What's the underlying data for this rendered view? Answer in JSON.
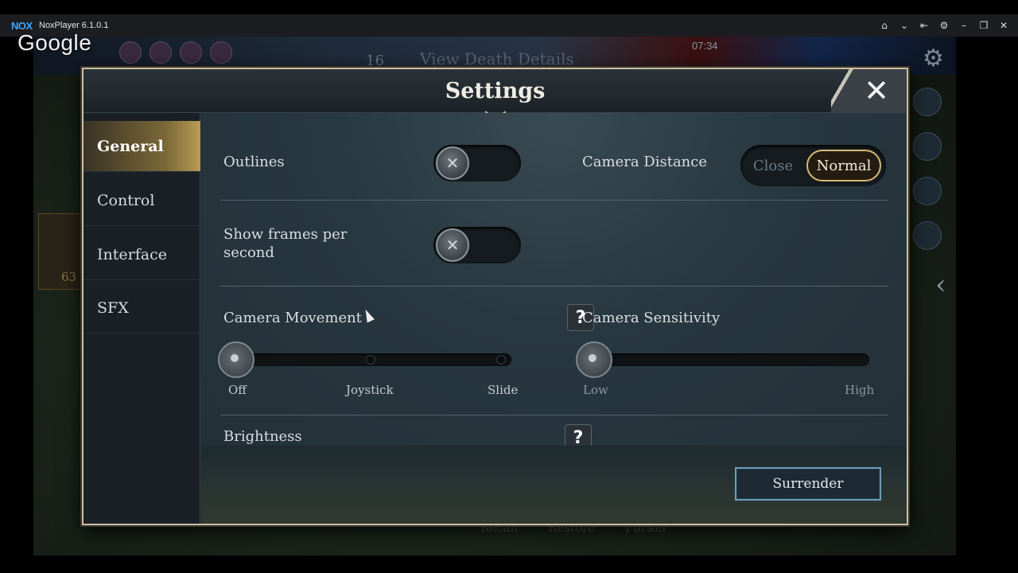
{
  "emulator": {
    "logo": "NOX",
    "version": "NoxPlayer 6.1.0.1",
    "google": "Google",
    "controls": [
      "home-icon",
      "chevron-down-icon",
      "pin-icon",
      "gear-icon",
      "minimize-icon",
      "restore-icon",
      "close-icon"
    ]
  },
  "game": {
    "kills": "16",
    "death_details": "View Death Details",
    "clock": "07:34",
    "skills": [
      "Recall",
      "Restore",
      "Flicker"
    ],
    "shop_gold": "63"
  },
  "dialog": {
    "title": "Settings",
    "close_icon": "close-icon",
    "tabs": [
      {
        "label": "General",
        "active": true
      },
      {
        "label": "Control",
        "active": false
      },
      {
        "label": "Interface",
        "active": false
      },
      {
        "label": "SFX",
        "active": false
      }
    ],
    "outlines": {
      "label": "Outlines",
      "enabled": false
    },
    "camera_distance": {
      "label": "Camera Distance",
      "options": [
        "Close",
        "Normal"
      ],
      "selected": "Normal"
    },
    "show_fps": {
      "label_line1": "Show frames per",
      "label_line2": "second",
      "enabled": false
    },
    "camera_movement": {
      "label": "Camera Movement",
      "help": "?",
      "ticks": [
        "Off",
        "Joystick",
        "Slide"
      ],
      "selected": "Off"
    },
    "camera_sensitivity": {
      "label": "Camera Sensitivity",
      "ticks": [
        "Low",
        "High"
      ],
      "value": 0
    },
    "brightness": {
      "label": "Brightness",
      "help": "?"
    },
    "surrender": "Surrender"
  },
  "colors": {
    "dialog_border": "#c9bfa5",
    "active_tab": "#b99c55",
    "surrender_border": "#6d9eb6",
    "segment_selected": "#d7b874"
  }
}
